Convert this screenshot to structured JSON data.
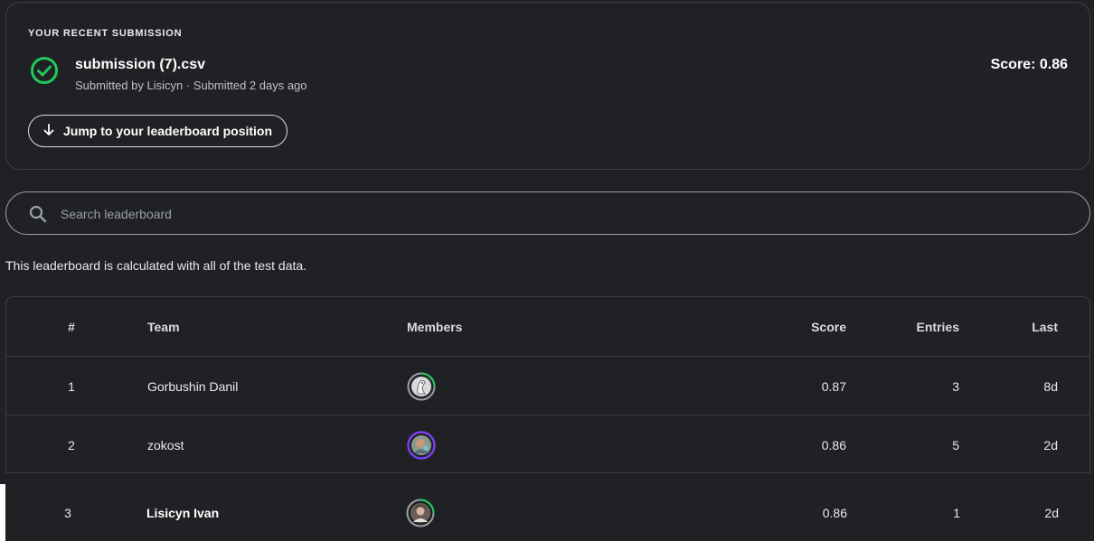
{
  "submission": {
    "heading": "YOUR RECENT SUBMISSION",
    "file_name": "submission (7).csv",
    "meta": "Submitted by Lisicyn · Submitted 2 days ago",
    "score": "Score: 0.86",
    "jump_label": "Jump to your leaderboard position"
  },
  "search": {
    "placeholder": "Search leaderboard"
  },
  "note": "This leaderboard is calculated with all of the test data.",
  "table": {
    "headers": {
      "rank": "#",
      "team": "Team",
      "members": "Members",
      "score": "Score",
      "entries": "Entries",
      "last": "Last"
    },
    "rows": [
      {
        "rank": "1",
        "team": "Gorbushin Danil",
        "score": "0.87",
        "entries": "3",
        "last": "8d",
        "avatar_ring": "#20c95a"
      },
      {
        "rank": "2",
        "team": "zokost",
        "score": "0.86",
        "entries": "5",
        "last": "2d",
        "avatar_ring": "#7b3ff2"
      }
    ],
    "current": {
      "rank": "3",
      "team": "Lisicyn Ivan",
      "score": "0.86",
      "entries": "1",
      "last": "2d",
      "avatar_ring": "#20c95a"
    }
  },
  "colors": {
    "accent_green": "#20c95a",
    "background": "#202124"
  }
}
